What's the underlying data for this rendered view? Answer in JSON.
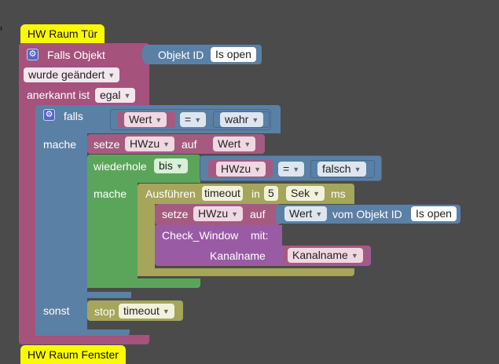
{
  "marker": "¹",
  "comment1": "HW Raum Tür",
  "comment2": "HW Raum Fenster",
  "trigger": {
    "label": "Falls Objekt",
    "object_id_label": "Objekt ID",
    "object_id_value": "Is open",
    "changed": "wurde geändert",
    "ack_label": "anerkannt ist",
    "ack_value": "egal"
  },
  "if_block": {
    "falls": "falls",
    "mache": "mache",
    "sonst": "sonst",
    "cond_var": "Wert",
    "cond_op": "=",
    "cond_val": "wahr"
  },
  "set1": {
    "label": "setze",
    "var": "HWzu",
    "auf": "auf",
    "value": "Wert"
  },
  "repeat": {
    "label": "wiederhole",
    "mode": "bis",
    "mache": "mache",
    "var": "HWzu",
    "op": "=",
    "val": "falsch"
  },
  "timeout_block": {
    "label": "Ausführen",
    "name": "timeout",
    "in": "in",
    "amount": "5",
    "unit": "Sek",
    "ms": "ms"
  },
  "set2": {
    "label": "setze",
    "var": "HWzu",
    "auf": "auf",
    "value": "Wert",
    "from_label": "vom Objekt ID",
    "object": "Is open"
  },
  "call": {
    "name": "Check_Window",
    "mit": "mit:",
    "param_label": "Kanalname",
    "param_value": "Kanalname"
  },
  "stop": {
    "label": "stop",
    "name": "timeout"
  },
  "colors": {
    "event": "#a5527d",
    "logic": "#5b80a5",
    "variable": "#a55b80",
    "loop": "#5ba55b",
    "timer": "#a5a55b",
    "procedure": "#9a5ba5",
    "comment": "#fbfb00",
    "background": "#4b4b4b"
  }
}
